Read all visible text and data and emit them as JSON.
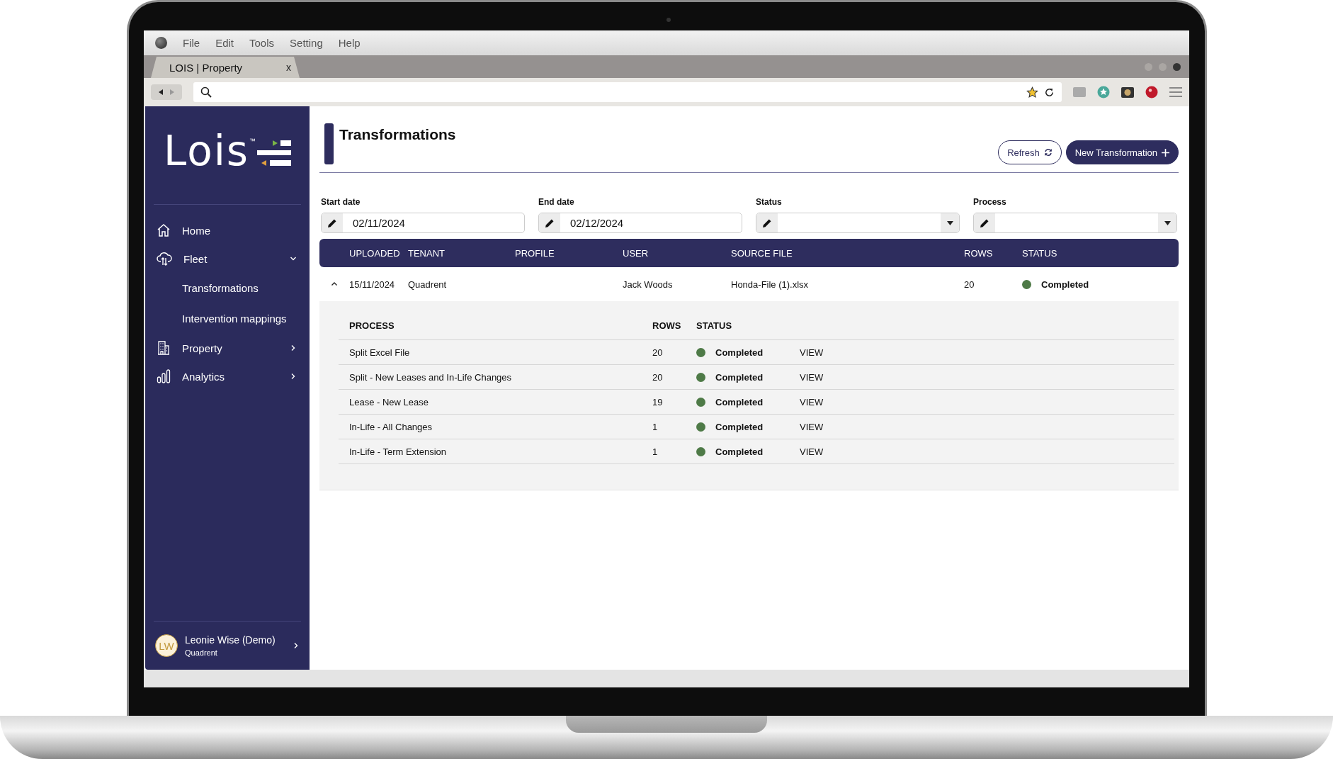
{
  "browser": {
    "menu": [
      "File",
      "Edit",
      "Tools",
      "Setting",
      "Help"
    ],
    "tab": {
      "title": "LOIS | Property",
      "close": "x"
    }
  },
  "sidebar": {
    "brand": "Lois",
    "trademark": "™",
    "items": [
      {
        "label": "Home",
        "kind": "home"
      },
      {
        "label": "Fleet",
        "kind": "cloud",
        "expanded": true,
        "children": [
          {
            "label": "Transformations"
          },
          {
            "label": "Intervention mappings"
          }
        ]
      },
      {
        "label": "Property",
        "kind": "building",
        "expanded": false
      },
      {
        "label": "Analytics",
        "kind": "chart",
        "expanded": false
      }
    ],
    "user": {
      "initials": "LW",
      "name": "Leonie Wise (Demo)",
      "organisation": "Quadrent"
    }
  },
  "page": {
    "title": "Transformations",
    "buttons": [
      {
        "label": "Refresh",
        "kind": "outline"
      },
      {
        "label": "New Transformation",
        "kind": "primary"
      }
    ],
    "filters": [
      {
        "label": "Start date",
        "value": "02/11/2024",
        "kind": "date"
      },
      {
        "label": "End date",
        "value": "02/12/2024",
        "kind": "date"
      },
      {
        "label": "Status",
        "kind": "select"
      },
      {
        "label": "Process",
        "kind": "select"
      }
    ],
    "table": {
      "columns": [
        "UPLOADED",
        "TENANT",
        "PROFILE",
        "USER",
        "SOURCE FILE",
        "ROWS",
        "STATUS"
      ],
      "rows": [
        {
          "expanded": true,
          "uploaded": "15/11/2024",
          "tenant": "Quadrent",
          "user": "Jack Woods",
          "source_file": "Honda-File (1).xlsx",
          "rows": "20",
          "status": "Completed",
          "color": "#4e7a47",
          "details": {
            "columns": [
              "PROCESS",
              "ROWS",
              "STATUS"
            ],
            "rows": [
              {
                "process": "Split Excel File",
                "rows": "20",
                "status": "Completed",
                "color": "#4e7a47",
                "action": "VIEW"
              },
              {
                "process": "Split - New Leases and In-Life Changes",
                "rows": "20",
                "status": "Completed",
                "color": "#4e7a47",
                "action": "VIEW"
              },
              {
                "process": "Lease - New Lease",
                "rows": "19",
                "status": "Completed",
                "color": "#4e7a47",
                "action": "VIEW"
              },
              {
                "process": "In-Life - All Changes",
                "rows": "1",
                "status": "Completed",
                "color": "#4e7a47",
                "action": "VIEW"
              },
              {
                "process": "In-Life - Term Extension",
                "rows": "1",
                "status": "Completed",
                "color": "#4e7a47",
                "action": "VIEW"
              }
            ]
          }
        }
      ]
    }
  }
}
